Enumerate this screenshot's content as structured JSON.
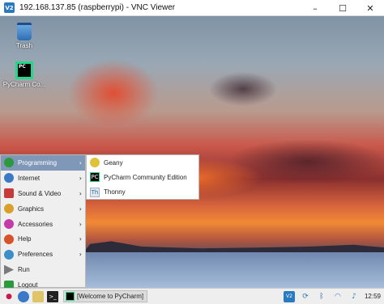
{
  "window": {
    "logo_text": "V2",
    "title": "192.168.137.85 (raspberrypi) - VNC Viewer",
    "minimize": "–",
    "maximize": "☐",
    "close": "✕"
  },
  "desktop": {
    "icons": [
      {
        "label": "Trash",
        "icon": "trash-icon"
      },
      {
        "label": "PyCharm Co...",
        "icon": "pycharm-icon",
        "icon_text": "PC"
      }
    ]
  },
  "menu": {
    "items": [
      {
        "label": "Programming",
        "icon": "programming-icon",
        "color": "#2c9a3c",
        "has_submenu": true,
        "active": true
      },
      {
        "label": "Internet",
        "icon": "internet-globe-icon",
        "color": "#3a79c8",
        "has_submenu": true
      },
      {
        "label": "Sound & Video",
        "icon": "sound-video-icon",
        "color": "#c83a3a",
        "has_submenu": true
      },
      {
        "label": "Graphics",
        "icon": "graphics-icon",
        "color": "#d9a12a",
        "has_submenu": true
      },
      {
        "label": "Accessories",
        "icon": "accessories-icon",
        "color": "#c43aa8",
        "has_submenu": true
      },
      {
        "label": "Help",
        "icon": "help-icon",
        "color": "#d9532a",
        "has_submenu": true
      },
      {
        "label": "Preferences",
        "icon": "preferences-icon",
        "color": "#3a8fc8",
        "has_submenu": true
      },
      {
        "label": "Run",
        "icon": "run-icon",
        "color": "#7a7a7a",
        "has_submenu": false
      },
      {
        "label": "Logout",
        "icon": "logout-icon",
        "color": "#2c9a3c",
        "has_submenu": false
      }
    ],
    "arrow": "›"
  },
  "submenu": {
    "items": [
      {
        "label": "Geany",
        "icon": "geany-icon",
        "glyph": "🐆",
        "color": "#e0c23a"
      },
      {
        "label": "PyCharm Community Edition",
        "icon": "pycharm-icon",
        "glyph": "PC",
        "color": "#000000"
      },
      {
        "label": "Thonny",
        "icon": "thonny-icon",
        "glyph": "Th",
        "color": "#3a6ea5"
      }
    ]
  },
  "taskbar": {
    "task_label": "[Welcome to PyCharm]",
    "clock": "12:59",
    "tray": [
      {
        "icon": "vnc-icon",
        "glyph": "V2"
      },
      {
        "icon": "update-icon",
        "glyph": "⟳"
      },
      {
        "icon": "bluetooth-icon",
        "glyph": "ᛒ"
      },
      {
        "icon": "wifi-icon",
        "glyph": "◠"
      },
      {
        "icon": "volume-icon",
        "glyph": "🔊"
      }
    ]
  }
}
